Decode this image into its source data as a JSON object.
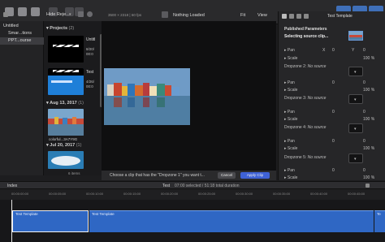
{
  "toolbar": {
    "hide_rejected": "Hide Reje...",
    "resolution_fps": "3500 × 2318 | 60 fps",
    "status": "Nothing Loaded",
    "fit": "Fit",
    "view": "View",
    "inspector_title": "Test Template"
  },
  "libraries": {
    "items": [
      {
        "label": "Untitled"
      },
      {
        "label": "Smar...tions"
      },
      {
        "label": "PPT...ourse"
      }
    ]
  },
  "browser": {
    "projects_header": "Projects",
    "projects_count": "(2)",
    "project1_name": "Untitl",
    "project1_date": "8/20/",
    "project1_time": "00:0",
    "project2_name": "Test",
    "project2_date": "4/26/",
    "project2_time": "00:0",
    "section2_header": "Aug 13, 2017",
    "section2_count": "(1)",
    "clip_label": "colorful...3A7Y9G",
    "section3_header": "Jul 20, 2017",
    "section3_count": "(1)",
    "items_count": "6 items"
  },
  "choose_bar": {
    "prompt": "Choose a clip that has the \"Dropzone 1\" you want t...",
    "cancel_label": "Cancel",
    "apply_label": "Apply Clip"
  },
  "inspector": {
    "published_params": "Published Parameters",
    "selecting_source": "Selecting source clip...",
    "pan_label": "Pan",
    "x_label": "X",
    "y_label": "Y",
    "x_val": "0",
    "y_val": "0",
    "scale_label": "Scale",
    "scale_val": "100 %",
    "dropzones": [
      {
        "label": "Dropzone 2:",
        "value": "No source"
      },
      {
        "label": "Dropzone 3:",
        "value": "No source"
      },
      {
        "label": "Dropzone 4:",
        "value": "No source"
      },
      {
        "label": "Dropzone 5:",
        "value": "No source"
      }
    ]
  },
  "timeline": {
    "index_label": "Index",
    "project_name": "Test",
    "duration_text": "07:00 selected / 51:18 total duration",
    "ticks": [
      "00:00:00:00",
      "00:00:05:00",
      "00:00:10:00",
      "00:00:15:00",
      "00:00:20:00",
      "00:00:25:00",
      "00:00:30:00",
      "00:00:35:00",
      "00:00:40:00",
      "00:00:45:00"
    ],
    "clips": [
      {
        "name": "Test Template"
      },
      {
        "name": "Test Template"
      },
      {
        "name": "Te"
      }
    ]
  },
  "colors": {
    "accent_blue": "#2f67c4",
    "selected_blue": "#3f6fb8"
  },
  "icons": [
    "library-icon",
    "import-icon",
    "key-icon",
    "filmstrip-icon",
    "inspector-icon",
    "dropdown-icon"
  ]
}
